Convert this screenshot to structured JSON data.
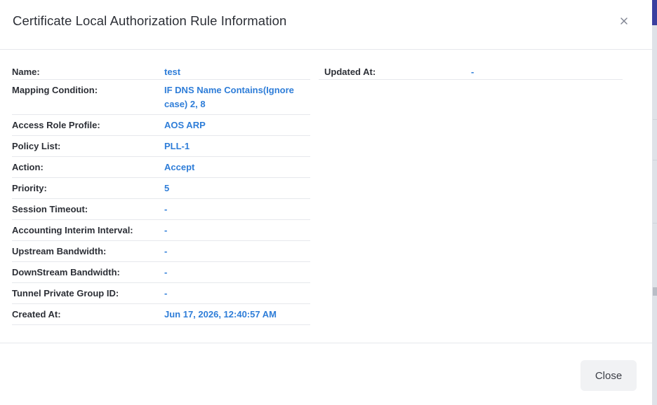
{
  "modal": {
    "title": "Certificate Local Authorization Rule Information",
    "close_icon": "close-x-icon"
  },
  "details_left": [
    {
      "label": "Name:",
      "value": "test"
    },
    {
      "label": "Mapping Condition:",
      "value": "IF DNS Name Contains(Ignore case) 2, 8"
    },
    {
      "label": "Access Role Profile:",
      "value": "AOS ARP"
    },
    {
      "label": "Policy List:",
      "value": "PLL-1"
    },
    {
      "label": "Action:",
      "value": "Accept"
    },
    {
      "label": "Priority:",
      "value": "5"
    },
    {
      "label": "Session Timeout:",
      "value": "-"
    },
    {
      "label": "Accounting Interim Interval:",
      "value": "-"
    },
    {
      "label": "Upstream Bandwidth:",
      "value": "-"
    },
    {
      "label": "DownStream Bandwidth:",
      "value": "-"
    },
    {
      "label": "Tunnel Private Group ID:",
      "value": "-"
    },
    {
      "label": "Created At:",
      "value": "Jun 17, 2026, 12:40:57 AM"
    }
  ],
  "details_right": [
    {
      "label": "Updated At:",
      "value": "-"
    }
  ],
  "footer": {
    "close_label": "Close"
  },
  "colors": {
    "value_text": "#2e7dd8",
    "label_text": "#2c2f36",
    "divider": "#e6e8ec",
    "button_bg": "#f1f2f4"
  }
}
